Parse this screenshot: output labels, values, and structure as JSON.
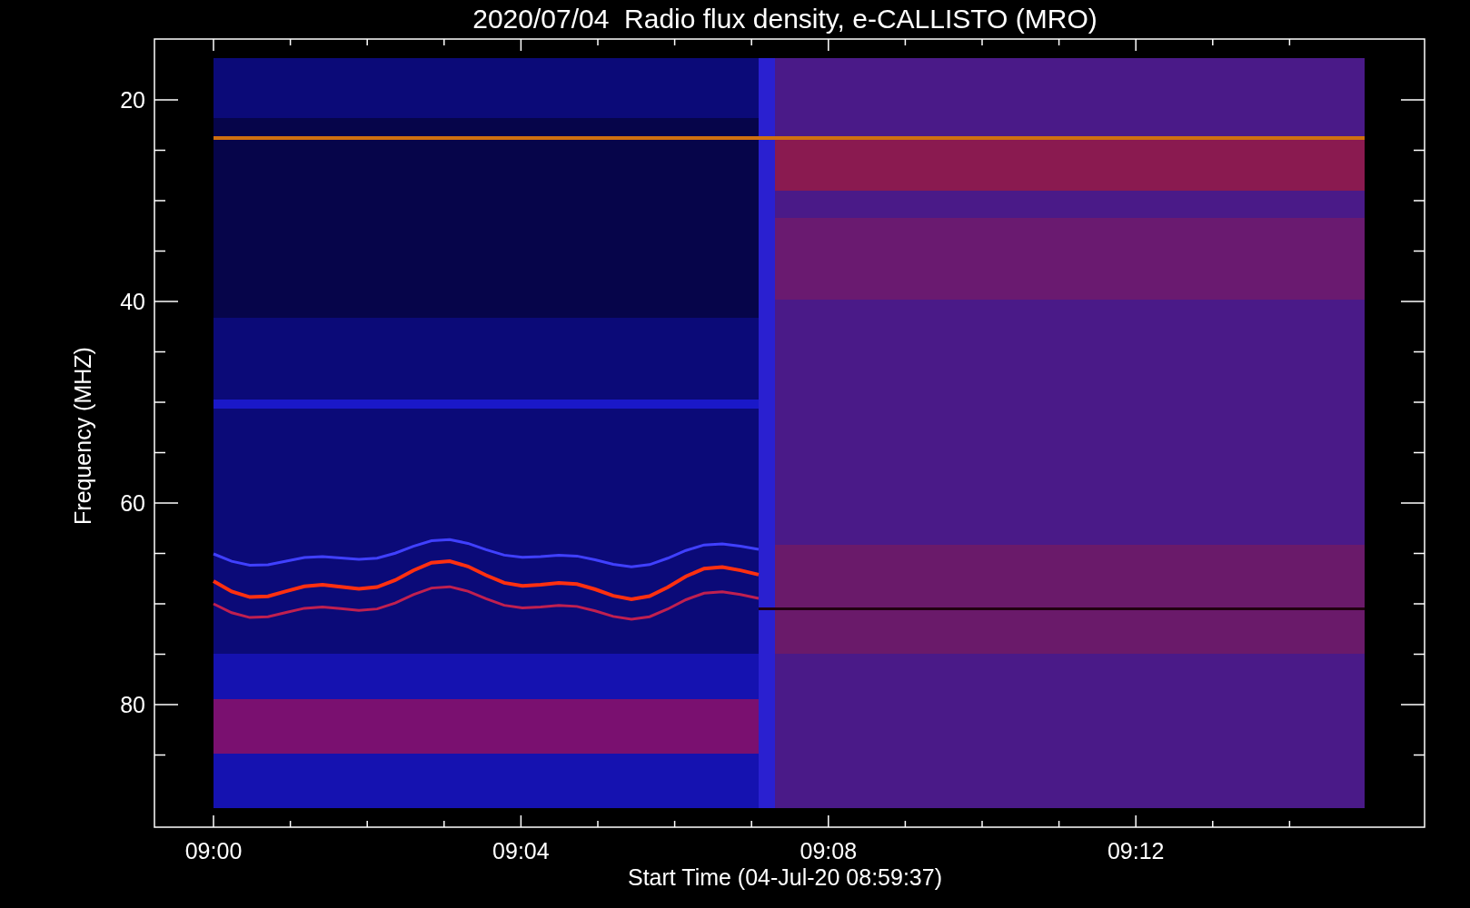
{
  "title": "2020/07/04  Radio flux density, e-CALLISTO (MRO)",
  "y_axis": {
    "label": "Frequency (MHZ)",
    "ticks": [
      "20",
      "40",
      "60",
      "80"
    ]
  },
  "x_axis": {
    "label": "Start Time (04-Jul-20 08:59:37)",
    "ticks": [
      "09:00",
      "09:04",
      "09:08",
      "09:12"
    ]
  }
}
